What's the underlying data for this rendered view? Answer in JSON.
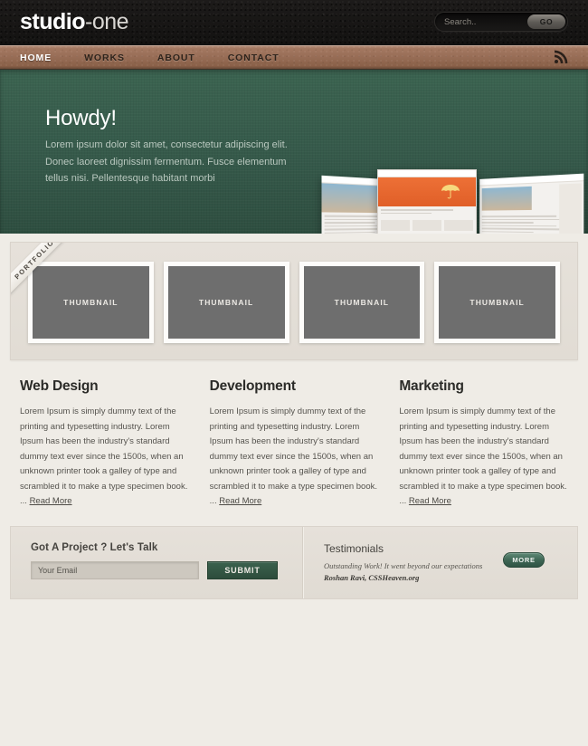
{
  "header": {
    "logo_bold": "studio",
    "logo_thin": "-one",
    "search_placeholder": "Search..",
    "search_value": "",
    "go_label": "GO",
    "rss_icon": "rss-icon"
  },
  "nav": {
    "items": [
      {
        "label": "HOME",
        "active": true
      },
      {
        "label": "WORKS",
        "active": false
      },
      {
        "label": "ABOUT",
        "active": false
      },
      {
        "label": "CONTACT",
        "active": false
      }
    ]
  },
  "hero": {
    "title": "Howdy!",
    "text": "Lorem ipsum dolor sit amet, consectetur adipiscing elit. Donec laoreet dignissim fermentum. Fusce elementum tellus nisi. Pellentesque habitant morbi",
    "slider_dots": 3,
    "active_dot": 0,
    "background_color": "#35594a"
  },
  "portfolio": {
    "ribbon_label": "PORTFOLIO",
    "thumbnails": [
      {
        "label": "THUMBNAIL"
      },
      {
        "label": "THUMBNAIL"
      },
      {
        "label": "THUMBNAIL"
      },
      {
        "label": "THUMBNAIL"
      }
    ]
  },
  "columns": [
    {
      "title": "Web Design",
      "body": "Lorem Ipsum is simply dummy text of the printing and typesetting industry. Lorem Ipsum has been the industry's standard dummy text ever since the 1500s, when an unknown printer took a galley of type and scrambled it to make a type specimen book. ... ",
      "readmore": "Read More"
    },
    {
      "title": "Development",
      "body": "Lorem Ipsum is simply dummy text of the printing and typesetting industry. Lorem Ipsum has been the industry's standard dummy text ever since the 1500s, when an unknown printer took a galley of type and scrambled it to make a type specimen book. ... ",
      "readmore": "Read More"
    },
    {
      "title": "Marketing",
      "body": "Lorem Ipsum is simply dummy text of the printing and typesetting industry. Lorem Ipsum has been the industry's standard dummy text ever since the 1500s, when an unknown printer took a galley of type and scrambled it to make a type specimen book. ... ",
      "readmore": "Read More"
    }
  ],
  "contact": {
    "title": "Got A Project ? Let's Talk",
    "email_placeholder": "Your Email",
    "email_value": "",
    "submit_label": "SUBMIT"
  },
  "testimonials": {
    "title": "Testimonials",
    "quote": "Outstanding Work! It went beyond our expectations ",
    "author": "Roshan Ravi, CSSHeaven.org",
    "more_label": "MORE"
  },
  "colors": {
    "header_bg": "#161514",
    "nav_bg": "#9b7059",
    "hero_green": "#35594a",
    "page_bg": "#efece6",
    "panel_bg": "#e4dfd8",
    "accent_green": "#2d4c3c",
    "thumb_gray": "#6e6e6e"
  }
}
